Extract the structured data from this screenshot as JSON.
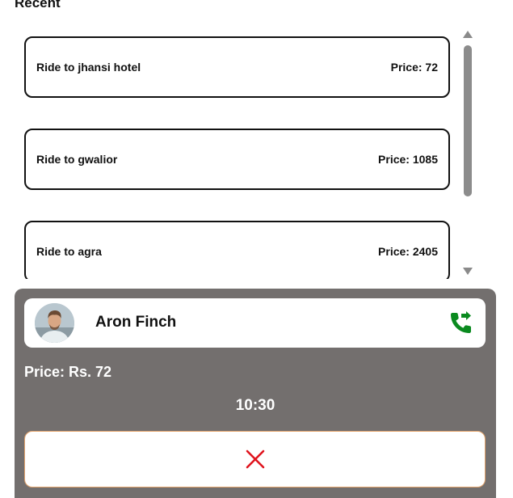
{
  "recent": {
    "title": "Recent",
    "rides": [
      {
        "destination": "Ride to jhansi hotel",
        "price": "Price: 72"
      },
      {
        "destination": "Ride to gwalior",
        "price": "Price: 1085"
      },
      {
        "destination": "Ride to agra",
        "price": "Price: 2405"
      }
    ]
  },
  "driver": {
    "name": "Aron Finch",
    "avatar_icon": "driver-avatar",
    "call_icon": "phone-forward-icon",
    "call_color": "#0a8a1f"
  },
  "trip": {
    "price": "Price: Rs. 72",
    "eta": "10:30"
  },
  "cancel": {
    "icon": "close-icon",
    "color": "#e0141e"
  },
  "colors": {
    "panel_bg": "#736f6e",
    "accent_border": "#e2a36c"
  }
}
